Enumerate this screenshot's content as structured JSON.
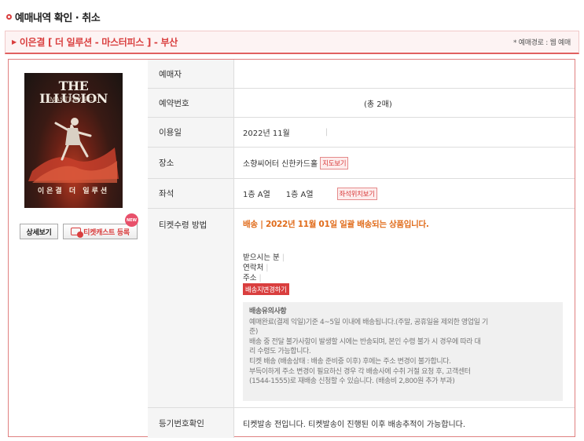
{
  "page": {
    "section_title": "예매내역 확인 · 취소",
    "title_bar": {
      "title": "이은결 [ 더 일루션 - 마스터피스 ] - 부산",
      "route": "* 예매경로 : 웹 예매"
    }
  },
  "poster": {
    "title": "THE ILLUSION",
    "subtitle": "MASTERPIECE",
    "name": "이은결 더 일루션"
  },
  "buttons": {
    "detail": "상세보기",
    "ticketcast": "티켓캐스트 등록",
    "new_badge": "NEW"
  },
  "info": {
    "buyer_label": "예매자",
    "buyer_value": "",
    "reservation_label": "예약번호",
    "reservation_count": "(총 2매)",
    "date_label": "이용일",
    "date_value": "2022년 11월",
    "venue_label": "장소",
    "venue_value": "소향씨어터 신한카드홀",
    "map_button": "지도보기",
    "seat_label": "좌석",
    "seat_1": "1층 A열",
    "seat_2": "1층 A열",
    "seat_map_button": "좌석위치보기",
    "ticket_method_label": "티켓수령 방법",
    "delivery_headline": "배송 | 2022년 11월 01일 일괄 배송되는 상품입니다.",
    "recipient_label": "받으시는 분",
    "contact_label": "연락처",
    "address_label": "주소",
    "change_address_button": "배송지변경하기",
    "notice_title": "배송유의사항",
    "notice_lines": [
      "예매완료(결제 익일)기준 4~5일 이내에 배송됩니다.(주말, 공휴일을 제외한 영업일 기",
      "준)",
      "배송 중 전달 불가사항이 발생할 시에는 반송되며, 본인 수령 불가 시 경우에 따라 대",
      "리 수령도 가능합니다.",
      "티켓 배송 (배송상태 : 배송 준비중 이후) 후에는 주소 변경이 불가합니다.",
      "부득이하게 주소 변경이 필요하신 경우 각 배송사에 수취 거절 요청 후, 고객센터",
      "(1544-1555)로 재배송 신청할 수 있습니다. (배송비 2,800원 추가 부과)"
    ],
    "registered_label": "등기번호확인",
    "registered_value": "티켓발송 전입니다. 티켓발송이 진행된 이후 배송추적이 가능합니다."
  }
}
